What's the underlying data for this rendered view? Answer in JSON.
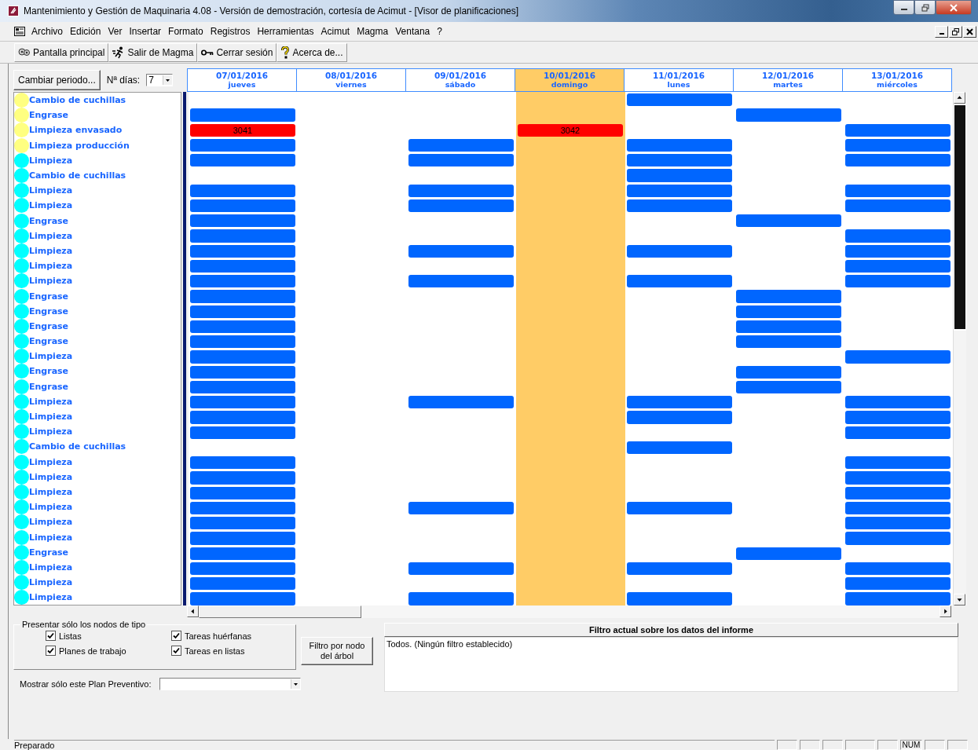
{
  "window": {
    "title": "Mantenimiento y Gestión de Maquinaria 4.08 - Versión de demostración, cortesía de Acimut - [Visor de planificaciones]"
  },
  "menu": [
    "Archivo",
    "Edición",
    "Ver",
    "Insertar",
    "Formato",
    "Registros",
    "Herramientas",
    "Acimut",
    "Magma",
    "Ventana",
    "?"
  ],
  "toolbar": [
    {
      "label": "Pantalla principal",
      "kind": "home"
    },
    {
      "label": "Salir de Magma",
      "kind": "exit"
    },
    {
      "label": "Cerrar sesión",
      "kind": "key"
    },
    {
      "label": "Acerca de...",
      "kind": "help"
    }
  ],
  "period_button": "Cambiar periodo...",
  "days_label": "Nª días:",
  "days_value": "7",
  "days": [
    {
      "date": "07/01/2016",
      "weekday": "jueves",
      "selected": false
    },
    {
      "date": "08/01/2016",
      "weekday": "viernes",
      "selected": false
    },
    {
      "date": "09/01/2016",
      "weekday": "sábado",
      "selected": false
    },
    {
      "date": "10/01/2016",
      "weekday": "domingo",
      "selected": true
    },
    {
      "date": "11/01/2016",
      "weekday": "lunes",
      "selected": false
    },
    {
      "date": "12/01/2016",
      "weekday": "martes",
      "selected": false
    },
    {
      "date": "13/01/2016",
      "weekday": "miércoles",
      "selected": false
    }
  ],
  "rows": [
    {
      "name": "Cambio de cuchillas",
      "color": "#ffff80",
      "slots": [
        {
          "kind": "none"
        },
        {
          "kind": "none"
        },
        {
          "kind": "none"
        },
        {
          "kind": "none"
        },
        {
          "kind": "task"
        },
        {
          "kind": "none"
        },
        {
          "kind": "none"
        }
      ]
    },
    {
      "name": "Engrase",
      "color": "#ffff80",
      "slots": [
        {
          "kind": "task"
        },
        {
          "kind": "none"
        },
        {
          "kind": "none"
        },
        {
          "kind": "none"
        },
        {
          "kind": "none"
        },
        {
          "kind": "task"
        },
        {
          "kind": "none"
        }
      ]
    },
    {
      "name": "Limpieza envasado",
      "color": "#ffff80",
      "slots": [
        {
          "kind": "overdue",
          "label": "3041"
        },
        {
          "kind": "none"
        },
        {
          "kind": "none"
        },
        {
          "kind": "overdue",
          "label": "3042"
        },
        {
          "kind": "none"
        },
        {
          "kind": "none"
        },
        {
          "kind": "task"
        }
      ]
    },
    {
      "name": "Limpieza producción",
      "color": "#ffff80",
      "slots": [
        {
          "kind": "task"
        },
        {
          "kind": "none"
        },
        {
          "kind": "task"
        },
        {
          "kind": "none"
        },
        {
          "kind": "task"
        },
        {
          "kind": "none"
        },
        {
          "kind": "task"
        }
      ]
    },
    {
      "name": "Limpieza",
      "color": "#00ffff",
      "slots": [
        {
          "kind": "task"
        },
        {
          "kind": "none"
        },
        {
          "kind": "task"
        },
        {
          "kind": "none"
        },
        {
          "kind": "task"
        },
        {
          "kind": "none"
        },
        {
          "kind": "task"
        }
      ]
    },
    {
      "name": "Cambio de cuchillas",
      "color": "#00ffff",
      "slots": [
        {
          "kind": "none"
        },
        {
          "kind": "none"
        },
        {
          "kind": "none"
        },
        {
          "kind": "none"
        },
        {
          "kind": "task"
        },
        {
          "kind": "none"
        },
        {
          "kind": "none"
        }
      ]
    },
    {
      "name": "Limpieza",
      "color": "#00ffff",
      "slots": [
        {
          "kind": "task"
        },
        {
          "kind": "none"
        },
        {
          "kind": "task"
        },
        {
          "kind": "none"
        },
        {
          "kind": "task"
        },
        {
          "kind": "none"
        },
        {
          "kind": "task"
        }
      ]
    },
    {
      "name": "Limpieza",
      "color": "#00ffff",
      "slots": [
        {
          "kind": "task"
        },
        {
          "kind": "none"
        },
        {
          "kind": "task"
        },
        {
          "kind": "none"
        },
        {
          "kind": "task"
        },
        {
          "kind": "none"
        },
        {
          "kind": "task"
        }
      ]
    },
    {
      "name": "Engrase",
      "color": "#00ffff",
      "slots": [
        {
          "kind": "task"
        },
        {
          "kind": "none"
        },
        {
          "kind": "none"
        },
        {
          "kind": "none"
        },
        {
          "kind": "none"
        },
        {
          "kind": "task"
        },
        {
          "kind": "none"
        }
      ]
    },
    {
      "name": "Limpieza",
      "color": "#00ffff",
      "slots": [
        {
          "kind": "task"
        },
        {
          "kind": "none"
        },
        {
          "kind": "none"
        },
        {
          "kind": "none"
        },
        {
          "kind": "none"
        },
        {
          "kind": "none"
        },
        {
          "kind": "task"
        }
      ]
    },
    {
      "name": "Limpieza",
      "color": "#00ffff",
      "slots": [
        {
          "kind": "task"
        },
        {
          "kind": "none"
        },
        {
          "kind": "task"
        },
        {
          "kind": "none"
        },
        {
          "kind": "task"
        },
        {
          "kind": "none"
        },
        {
          "kind": "task"
        }
      ]
    },
    {
      "name": "Limpieza",
      "color": "#00ffff",
      "slots": [
        {
          "kind": "task"
        },
        {
          "kind": "none"
        },
        {
          "kind": "none"
        },
        {
          "kind": "none"
        },
        {
          "kind": "none"
        },
        {
          "kind": "none"
        },
        {
          "kind": "task"
        }
      ]
    },
    {
      "name": "Limpieza",
      "color": "#00ffff",
      "slots": [
        {
          "kind": "task"
        },
        {
          "kind": "none"
        },
        {
          "kind": "task"
        },
        {
          "kind": "none"
        },
        {
          "kind": "task"
        },
        {
          "kind": "none"
        },
        {
          "kind": "task"
        }
      ]
    },
    {
      "name": "Engrase",
      "color": "#00ffff",
      "slots": [
        {
          "kind": "task"
        },
        {
          "kind": "none"
        },
        {
          "kind": "none"
        },
        {
          "kind": "none"
        },
        {
          "kind": "none"
        },
        {
          "kind": "task"
        },
        {
          "kind": "none"
        }
      ]
    },
    {
      "name": "Engrase",
      "color": "#00ffff",
      "slots": [
        {
          "kind": "task"
        },
        {
          "kind": "none"
        },
        {
          "kind": "none"
        },
        {
          "kind": "none"
        },
        {
          "kind": "none"
        },
        {
          "kind": "task"
        },
        {
          "kind": "none"
        }
      ]
    },
    {
      "name": "Engrase",
      "color": "#00ffff",
      "slots": [
        {
          "kind": "task"
        },
        {
          "kind": "none"
        },
        {
          "kind": "none"
        },
        {
          "kind": "none"
        },
        {
          "kind": "none"
        },
        {
          "kind": "task"
        },
        {
          "kind": "none"
        }
      ]
    },
    {
      "name": "Engrase",
      "color": "#00ffff",
      "slots": [
        {
          "kind": "task"
        },
        {
          "kind": "none"
        },
        {
          "kind": "none"
        },
        {
          "kind": "none"
        },
        {
          "kind": "none"
        },
        {
          "kind": "task"
        },
        {
          "kind": "none"
        }
      ]
    },
    {
      "name": "Limpieza",
      "color": "#00ffff",
      "slots": [
        {
          "kind": "task"
        },
        {
          "kind": "none"
        },
        {
          "kind": "none"
        },
        {
          "kind": "none"
        },
        {
          "kind": "none"
        },
        {
          "kind": "none"
        },
        {
          "kind": "task"
        }
      ]
    },
    {
      "name": "Engrase",
      "color": "#00ffff",
      "slots": [
        {
          "kind": "task"
        },
        {
          "kind": "none"
        },
        {
          "kind": "none"
        },
        {
          "kind": "none"
        },
        {
          "kind": "none"
        },
        {
          "kind": "task"
        },
        {
          "kind": "none"
        }
      ]
    },
    {
      "name": "Engrase",
      "color": "#00ffff",
      "slots": [
        {
          "kind": "task"
        },
        {
          "kind": "none"
        },
        {
          "kind": "none"
        },
        {
          "kind": "none"
        },
        {
          "kind": "none"
        },
        {
          "kind": "task"
        },
        {
          "kind": "none"
        }
      ]
    },
    {
      "name": "Limpieza",
      "color": "#00ffff",
      "slots": [
        {
          "kind": "task"
        },
        {
          "kind": "none"
        },
        {
          "kind": "task"
        },
        {
          "kind": "none"
        },
        {
          "kind": "task"
        },
        {
          "kind": "none"
        },
        {
          "kind": "task"
        }
      ]
    },
    {
      "name": "Limpieza",
      "color": "#00ffff",
      "slots": [
        {
          "kind": "task"
        },
        {
          "kind": "none"
        },
        {
          "kind": "none"
        },
        {
          "kind": "none"
        },
        {
          "kind": "task"
        },
        {
          "kind": "none"
        },
        {
          "kind": "task"
        }
      ]
    },
    {
      "name": "Limpieza",
      "color": "#00ffff",
      "slots": [
        {
          "kind": "task"
        },
        {
          "kind": "none"
        },
        {
          "kind": "none"
        },
        {
          "kind": "none"
        },
        {
          "kind": "none"
        },
        {
          "kind": "none"
        },
        {
          "kind": "task"
        }
      ]
    },
    {
      "name": "Cambio de cuchillas",
      "color": "#00ffff",
      "slots": [
        {
          "kind": "none"
        },
        {
          "kind": "none"
        },
        {
          "kind": "none"
        },
        {
          "kind": "none"
        },
        {
          "kind": "task"
        },
        {
          "kind": "none"
        },
        {
          "kind": "none"
        }
      ]
    },
    {
      "name": "Limpieza",
      "color": "#00ffff",
      "slots": [
        {
          "kind": "task"
        },
        {
          "kind": "none"
        },
        {
          "kind": "none"
        },
        {
          "kind": "none"
        },
        {
          "kind": "none"
        },
        {
          "kind": "none"
        },
        {
          "kind": "task"
        }
      ]
    },
    {
      "name": "Limpieza",
      "color": "#00ffff",
      "slots": [
        {
          "kind": "task"
        },
        {
          "kind": "none"
        },
        {
          "kind": "none"
        },
        {
          "kind": "none"
        },
        {
          "kind": "none"
        },
        {
          "kind": "none"
        },
        {
          "kind": "task"
        }
      ]
    },
    {
      "name": "Limpieza",
      "color": "#00ffff",
      "slots": [
        {
          "kind": "task"
        },
        {
          "kind": "none"
        },
        {
          "kind": "none"
        },
        {
          "kind": "none"
        },
        {
          "kind": "none"
        },
        {
          "kind": "none"
        },
        {
          "kind": "task"
        }
      ]
    },
    {
      "name": "Limpieza",
      "color": "#00ffff",
      "slots": [
        {
          "kind": "task"
        },
        {
          "kind": "none"
        },
        {
          "kind": "task"
        },
        {
          "kind": "none"
        },
        {
          "kind": "task"
        },
        {
          "kind": "none"
        },
        {
          "kind": "task"
        }
      ]
    },
    {
      "name": "Limpieza",
      "color": "#00ffff",
      "slots": [
        {
          "kind": "task"
        },
        {
          "kind": "none"
        },
        {
          "kind": "none"
        },
        {
          "kind": "none"
        },
        {
          "kind": "none"
        },
        {
          "kind": "none"
        },
        {
          "kind": "task"
        }
      ]
    },
    {
      "name": "Limpieza",
      "color": "#00ffff",
      "slots": [
        {
          "kind": "task"
        },
        {
          "kind": "none"
        },
        {
          "kind": "none"
        },
        {
          "kind": "none"
        },
        {
          "kind": "none"
        },
        {
          "kind": "none"
        },
        {
          "kind": "task"
        }
      ]
    },
    {
      "name": "Engrase",
      "color": "#00ffff",
      "slots": [
        {
          "kind": "task"
        },
        {
          "kind": "none"
        },
        {
          "kind": "none"
        },
        {
          "kind": "none"
        },
        {
          "kind": "none"
        },
        {
          "kind": "task"
        },
        {
          "kind": "none"
        }
      ]
    },
    {
      "name": "Limpieza",
      "color": "#00ffff",
      "slots": [
        {
          "kind": "task"
        },
        {
          "kind": "none"
        },
        {
          "kind": "task"
        },
        {
          "kind": "none"
        },
        {
          "kind": "task"
        },
        {
          "kind": "none"
        },
        {
          "kind": "task"
        }
      ]
    },
    {
      "name": "Limpieza",
      "color": "#00ffff",
      "slots": [
        {
          "kind": "task"
        },
        {
          "kind": "none"
        },
        {
          "kind": "none"
        },
        {
          "kind": "none"
        },
        {
          "kind": "none"
        },
        {
          "kind": "none"
        },
        {
          "kind": "task"
        }
      ]
    },
    {
      "name": "Limpieza",
      "color": "#00ffff",
      "slots": [
        {
          "kind": "task"
        },
        {
          "kind": "none"
        },
        {
          "kind": "task"
        },
        {
          "kind": "none"
        },
        {
          "kind": "task"
        },
        {
          "kind": "none"
        },
        {
          "kind": "task"
        }
      ]
    }
  ],
  "node_filter": {
    "title": "Presentar sólo los nodos de tipo",
    "options": [
      {
        "label": "Listas",
        "checked": true
      },
      {
        "label": "Tareas huérfanas",
        "checked": true
      },
      {
        "label": "Planes de trabajo",
        "checked": true
      },
      {
        "label": "Tareas en listas",
        "checked": true
      }
    ]
  },
  "tree_filter_button": "Filtro por nodo del árbol",
  "plan_filter": {
    "label": "Mostrar sólo este Plan Preventivo:"
  },
  "current_filter": {
    "title": "Filtro actual sobre los datos del informe",
    "text": "Todos. (Ningún filtro establecido)"
  },
  "status_bar": {
    "text": "Preparado",
    "indicators": [
      "NUM"
    ]
  }
}
